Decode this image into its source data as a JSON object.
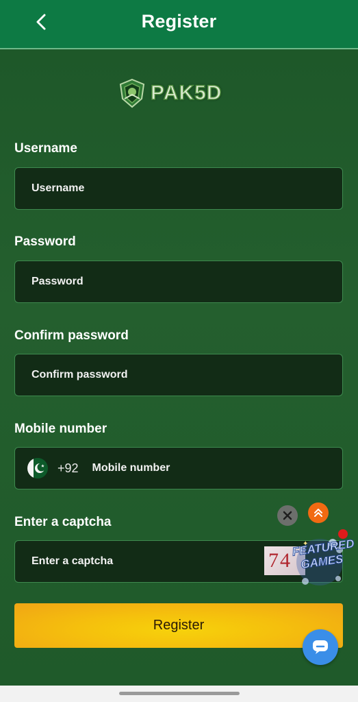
{
  "header": {
    "title": "Register",
    "back_icon": "chevron-left-icon"
  },
  "logo": {
    "text": "PAK5D"
  },
  "form": {
    "username": {
      "label": "Username",
      "placeholder": "Username"
    },
    "password": {
      "label": "Password",
      "placeholder": "Password"
    },
    "confirm_password": {
      "label": "Confirm password",
      "placeholder": "Confirm password"
    },
    "mobile": {
      "label": "Mobile number",
      "country_code": "+92",
      "placeholder": "Mobile number",
      "flag": "pakistan-flag-icon"
    },
    "captcha": {
      "label": "Enter a captcha",
      "placeholder": "Enter a captcha",
      "image_text": "74"
    }
  },
  "floating": {
    "featured_text": "FEATURED GAMES",
    "close_icon": "close-icon",
    "scroll_up_icon": "double-chevron-up-icon",
    "chat_icon": "chat-icon"
  },
  "actions": {
    "register_label": "Register"
  },
  "colors": {
    "header": "#0d7a44",
    "background": "#1f5a2b",
    "field": "#122c16",
    "button": "#f5bf0d",
    "chat": "#3a8ee8",
    "scroll_up": "#f26a12"
  }
}
